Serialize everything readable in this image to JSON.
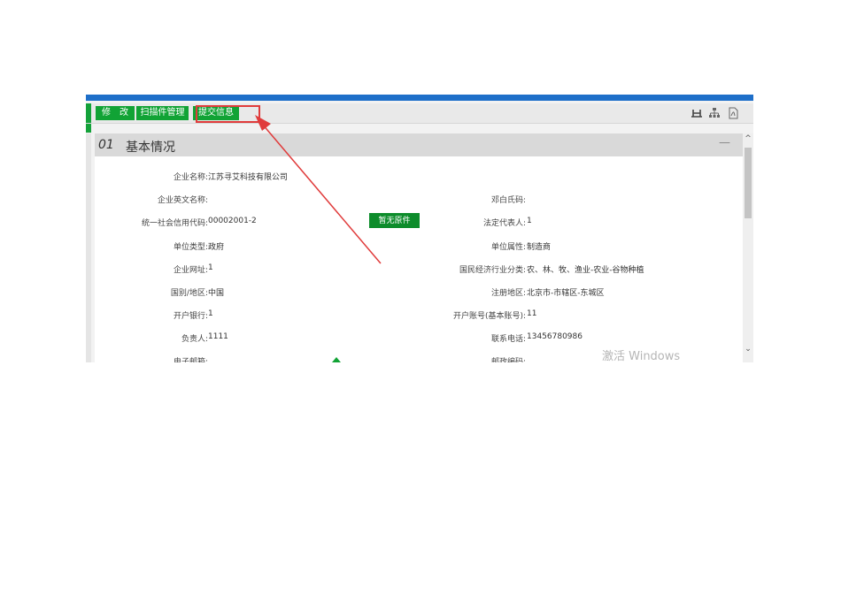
{
  "toolbar": {
    "buttons": [
      {
        "label": "修　改"
      },
      {
        "label": "扫描件管理"
      },
      {
        "label": "提交信息"
      }
    ],
    "icons": [
      "hierarchy-h-icon",
      "org-chart-icon",
      "pdf-icon"
    ]
  },
  "section": {
    "number": "01",
    "title": "基本情况",
    "collapse_symbol": "—"
  },
  "fields": {
    "left": [
      {
        "label": "企业名称:",
        "value": "江苏寻艾科技有限公司"
      },
      {
        "label": "企业英文名称:",
        "value": ""
      },
      {
        "label": "统一社会信用代码:",
        "value": "00002001-2"
      },
      {
        "label": "单位类型:",
        "value": "政府"
      },
      {
        "label": "企业网址:",
        "value": "1"
      },
      {
        "label": "国别/地区:",
        "value": "中国"
      },
      {
        "label": "开户银行:",
        "value": "1"
      },
      {
        "label": "负责人:",
        "value": "1111"
      },
      {
        "label": "电子邮箱:",
        "value": ""
      }
    ],
    "right": [
      {
        "label": "",
        "value": ""
      },
      {
        "label": "邓白氏码:",
        "value": ""
      },
      {
        "label": "法定代表人:",
        "value": "1"
      },
      {
        "label": "单位属性:",
        "value": "制造商"
      },
      {
        "label": "国民经济行业分类:",
        "value": "农、林、牧、渔业-农业-谷物种植"
      },
      {
        "label": "注册地区:",
        "value": "北京市-市辖区-东城区"
      },
      {
        "label": "开户账号(基本账号):",
        "value": "11"
      },
      {
        "label": "联系电话:",
        "value": "13456780986"
      },
      {
        "label": "邮政编码:",
        "value": ""
      }
    ]
  },
  "no_original_button": "暂无原件",
  "watermark": "激活 Windows",
  "colors": {
    "accent_green": "#11a335",
    "top_bar_blue": "#1e6fc9",
    "annotation_red": "#e03b3b"
  }
}
